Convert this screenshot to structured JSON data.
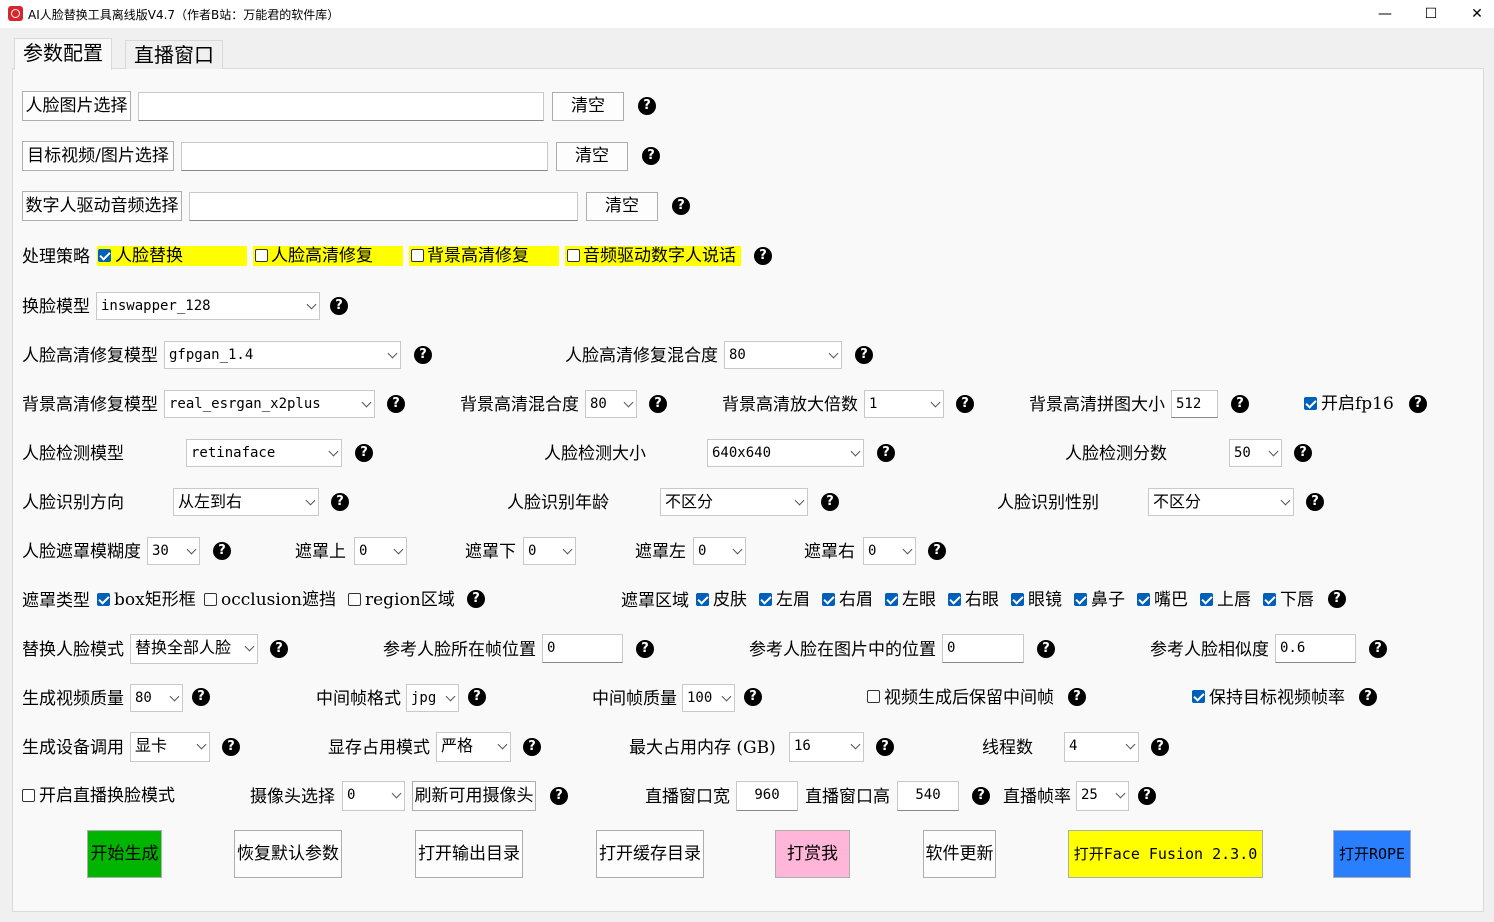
{
  "window": {
    "title": "AI人脸替换工具离线版V4.7（作者B站：万能君的软件库）",
    "minimize": "—",
    "maximize": "☐",
    "close": "✕"
  },
  "tabs": [
    "参数配置",
    "直播窗口"
  ],
  "colors": {
    "start_bg": "#00b400",
    "reward_bg": "#ffb6d9",
    "facefusion_bg": "#ffff00",
    "rope_bg": "#2a7fff",
    "highlight": "#ffff00"
  },
  "file": {
    "face_btn": "人脸图片选择",
    "face_value": "",
    "target_btn": "目标视频/图片选择",
    "target_value": "",
    "audio_btn": "数字人驱动音频选择",
    "audio_value": "",
    "clear": "清空"
  },
  "strategy": {
    "label": "处理策略",
    "opts": [
      "人脸替换",
      "人脸高清修复",
      "背景高清修复",
      "音频驱动数字人说话"
    ],
    "checked": [
      true,
      false,
      false,
      false
    ]
  },
  "swap_model": {
    "label": "换脸模型",
    "value": "inswapper_128"
  },
  "face_enhance": {
    "label": "人脸高清修复模型",
    "value": "gfpgan_1.4",
    "blend_label": "人脸高清修复混合度",
    "blend": "80"
  },
  "bg_enhance": {
    "label": "背景高清修复模型",
    "value": "real_esrgan_x2plus",
    "blend_label": "背景高清混合度",
    "blend": "80",
    "scale_label": "背景高清放大倍数",
    "scale": "1",
    "tile_label": "背景高清拼图大小",
    "tile": "512",
    "fp16_label": "开启fp16",
    "fp16": true
  },
  "detect": {
    "label": "人脸检测模型",
    "value": "retinaface",
    "size_label": "人脸检测大小",
    "size": "640x640",
    "score_label": "人脸检测分数",
    "score": "50"
  },
  "recognize": {
    "dir_label": "人脸识别方向",
    "dir": "从左到右",
    "age_label": "人脸识别年龄",
    "age": "不区分",
    "gender_label": "人脸识别性别",
    "gender": "不区分"
  },
  "mask": {
    "blur_label": "人脸遮罩模糊度",
    "blur": "30",
    "top_label": "遮罩上",
    "top": "0",
    "bottom_label": "遮罩下",
    "bottom": "0",
    "left_label": "遮罩左",
    "left": "0",
    "right_label": "遮罩右",
    "right": "0"
  },
  "mask_type": {
    "label": "遮罩类型",
    "opts": [
      "box矩形框",
      "occlusion遮挡",
      "region区域"
    ],
    "checked": [
      true,
      false,
      false
    ]
  },
  "mask_region": {
    "label": "遮罩区域",
    "opts": [
      "皮肤",
      "左眉",
      "右眉",
      "左眼",
      "右眼",
      "眼镜",
      "鼻子",
      "嘴巴",
      "上唇",
      "下唇"
    ],
    "checked": [
      true,
      true,
      true,
      true,
      true,
      true,
      true,
      true,
      true,
      true
    ]
  },
  "replace": {
    "mode_label": "替换人脸模式",
    "mode": "替换全部人脸",
    "frame_label": "参考人脸所在帧位置",
    "frame": "0",
    "pos_label": "参考人脸在图片中的位置",
    "pos": "0",
    "sim_label": "参考人脸相似度",
    "sim": "0.6"
  },
  "output": {
    "quality_label": "生成视频质量",
    "quality": "80",
    "fmt_label": "中间帧格式",
    "fmt": "jpg",
    "fq_label": "中间帧质量",
    "fq": "100",
    "keep_label": "视频生成后保留中间帧",
    "keep": false,
    "fps_label": "保持目标视频帧率",
    "fps": true
  },
  "device": {
    "label": "生成设备调用",
    "value": "显卡",
    "mem_mode_label": "显存占用模式",
    "mem_mode": "严格",
    "max_mem_label": "最大占用内存 (GB)",
    "max_mem": "16",
    "threads_label": "线程数",
    "threads": "4"
  },
  "live": {
    "enable_label": "开启直播换脸模式",
    "enable": false,
    "cam_label": "摄像头选择",
    "cam": "0",
    "refresh": "刷新可用摄像头",
    "w_label": "直播窗口宽",
    "w": "960",
    "h_label": "直播窗口高",
    "h": "540",
    "fps_label": "直播帧率",
    "fps": "25"
  },
  "actions": {
    "start": "开始生成",
    "reset": "恢复默认参数",
    "out_dir": "打开输出目录",
    "cache_dir": "打开缓存目录",
    "reward": "打赏我",
    "update": "软件更新",
    "facefusion": "打开Face Fusion 2.3.0",
    "rope": "打开ROPE"
  },
  "help_glyph": "?"
}
